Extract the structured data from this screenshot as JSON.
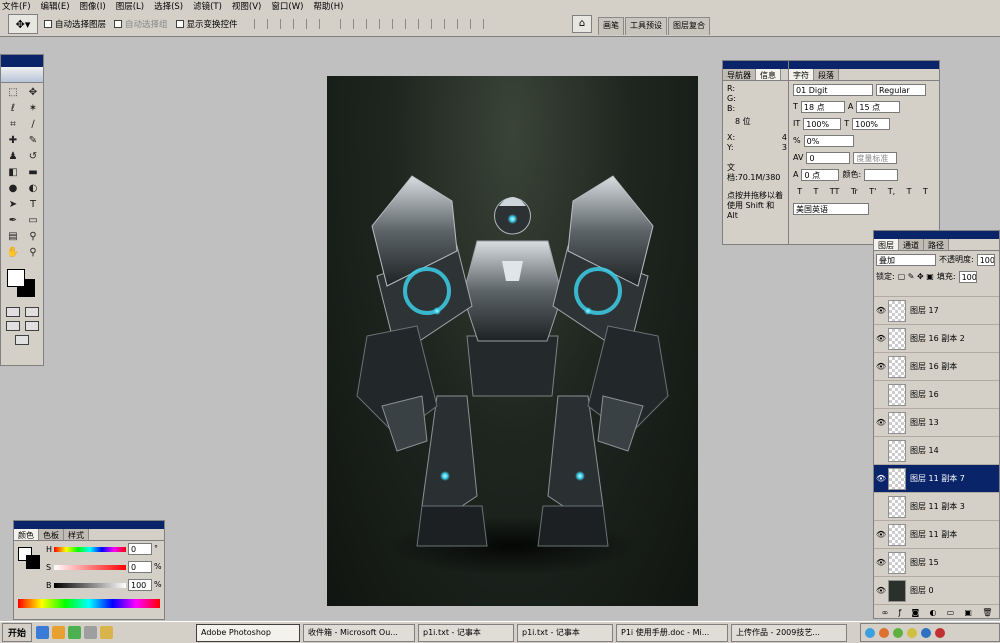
{
  "menu": [
    "文件(F)",
    "编辑(E)",
    "图像(I)",
    "图层(L)",
    "选择(S)",
    "滤镜(T)",
    "视图(V)",
    "窗口(W)",
    "帮助(H)"
  ],
  "options": {
    "auto_select_layer": "自动选择图层",
    "auto_select_group": "自动选择组",
    "show_transform": "显示变换控件"
  },
  "palette_well": [
    "画笔",
    "工具预设",
    "图层复合"
  ],
  "navigator": {
    "tabs": [
      "导航器",
      "信息"
    ],
    "r": "R:",
    "g": "G:",
    "b": "B:",
    "bits": "8 位",
    "x": "X:",
    "y": "Y:",
    "x_val": "4",
    "y_val": "3",
    "doc": "文档:70.1M/380",
    "hint1": "点按并拖移以着",
    "hint2": "使用 Shift 和 Alt"
  },
  "character": {
    "tabs": [
      "字符",
      "段落"
    ],
    "font": "01 Digit",
    "style": "Regular",
    "size": "18 点",
    "leading": "15 点",
    "vscale": "100%",
    "hscale": "100%",
    "tracking_pct": "0%",
    "kerning": "0",
    "kerning_mode": "度量标准",
    "baseline": "0 点",
    "color_label": "颜色:",
    "language": "美国英语",
    "style_glyphs": [
      "T",
      "T",
      "TT",
      "Tr",
      "T'",
      "T,",
      "T",
      "T"
    ]
  },
  "layers": {
    "tabs": [
      "图层",
      "通道",
      "路径"
    ],
    "blend": "叠加",
    "opacity_label": "不透明度:",
    "opacity": "100%",
    "lock_label": "锁定:",
    "fill_label": "填充:",
    "fill": "100%",
    "items": [
      {
        "name": "图层 17",
        "visible": true
      },
      {
        "name": "图层 16 副本 2",
        "visible": true
      },
      {
        "name": "图层 16 副本",
        "visible": true
      },
      {
        "name": "图层 16",
        "visible": false
      },
      {
        "name": "图层 13",
        "visible": true
      },
      {
        "name": "图层 14",
        "visible": false
      },
      {
        "name": "图层 11 副本 7",
        "visible": true,
        "selected": true
      },
      {
        "name": "图层 11 副本 3",
        "visible": false
      },
      {
        "name": "图层 11 副本",
        "visible": true
      },
      {
        "name": "图层 15",
        "visible": true
      },
      {
        "name": "图层 0",
        "visible": true
      }
    ]
  },
  "color": {
    "tabs": [
      "颜色",
      "色板",
      "样式"
    ],
    "h": "H",
    "s": "S",
    "b": "B",
    "h_val": "0",
    "s_val": "0",
    "b_val": "100",
    "deg": "°",
    "pct": "%"
  },
  "taskbar": {
    "start": "开始",
    "tasks": [
      "Adobe Photoshop",
      "收件箱 - Microsoft Ou...",
      "p1i.txt - 记事本",
      "p1i.txt - 记事本",
      "P1i 使用手册.doc - Mi...",
      "上传作品 - 2009技艺..."
    ]
  }
}
